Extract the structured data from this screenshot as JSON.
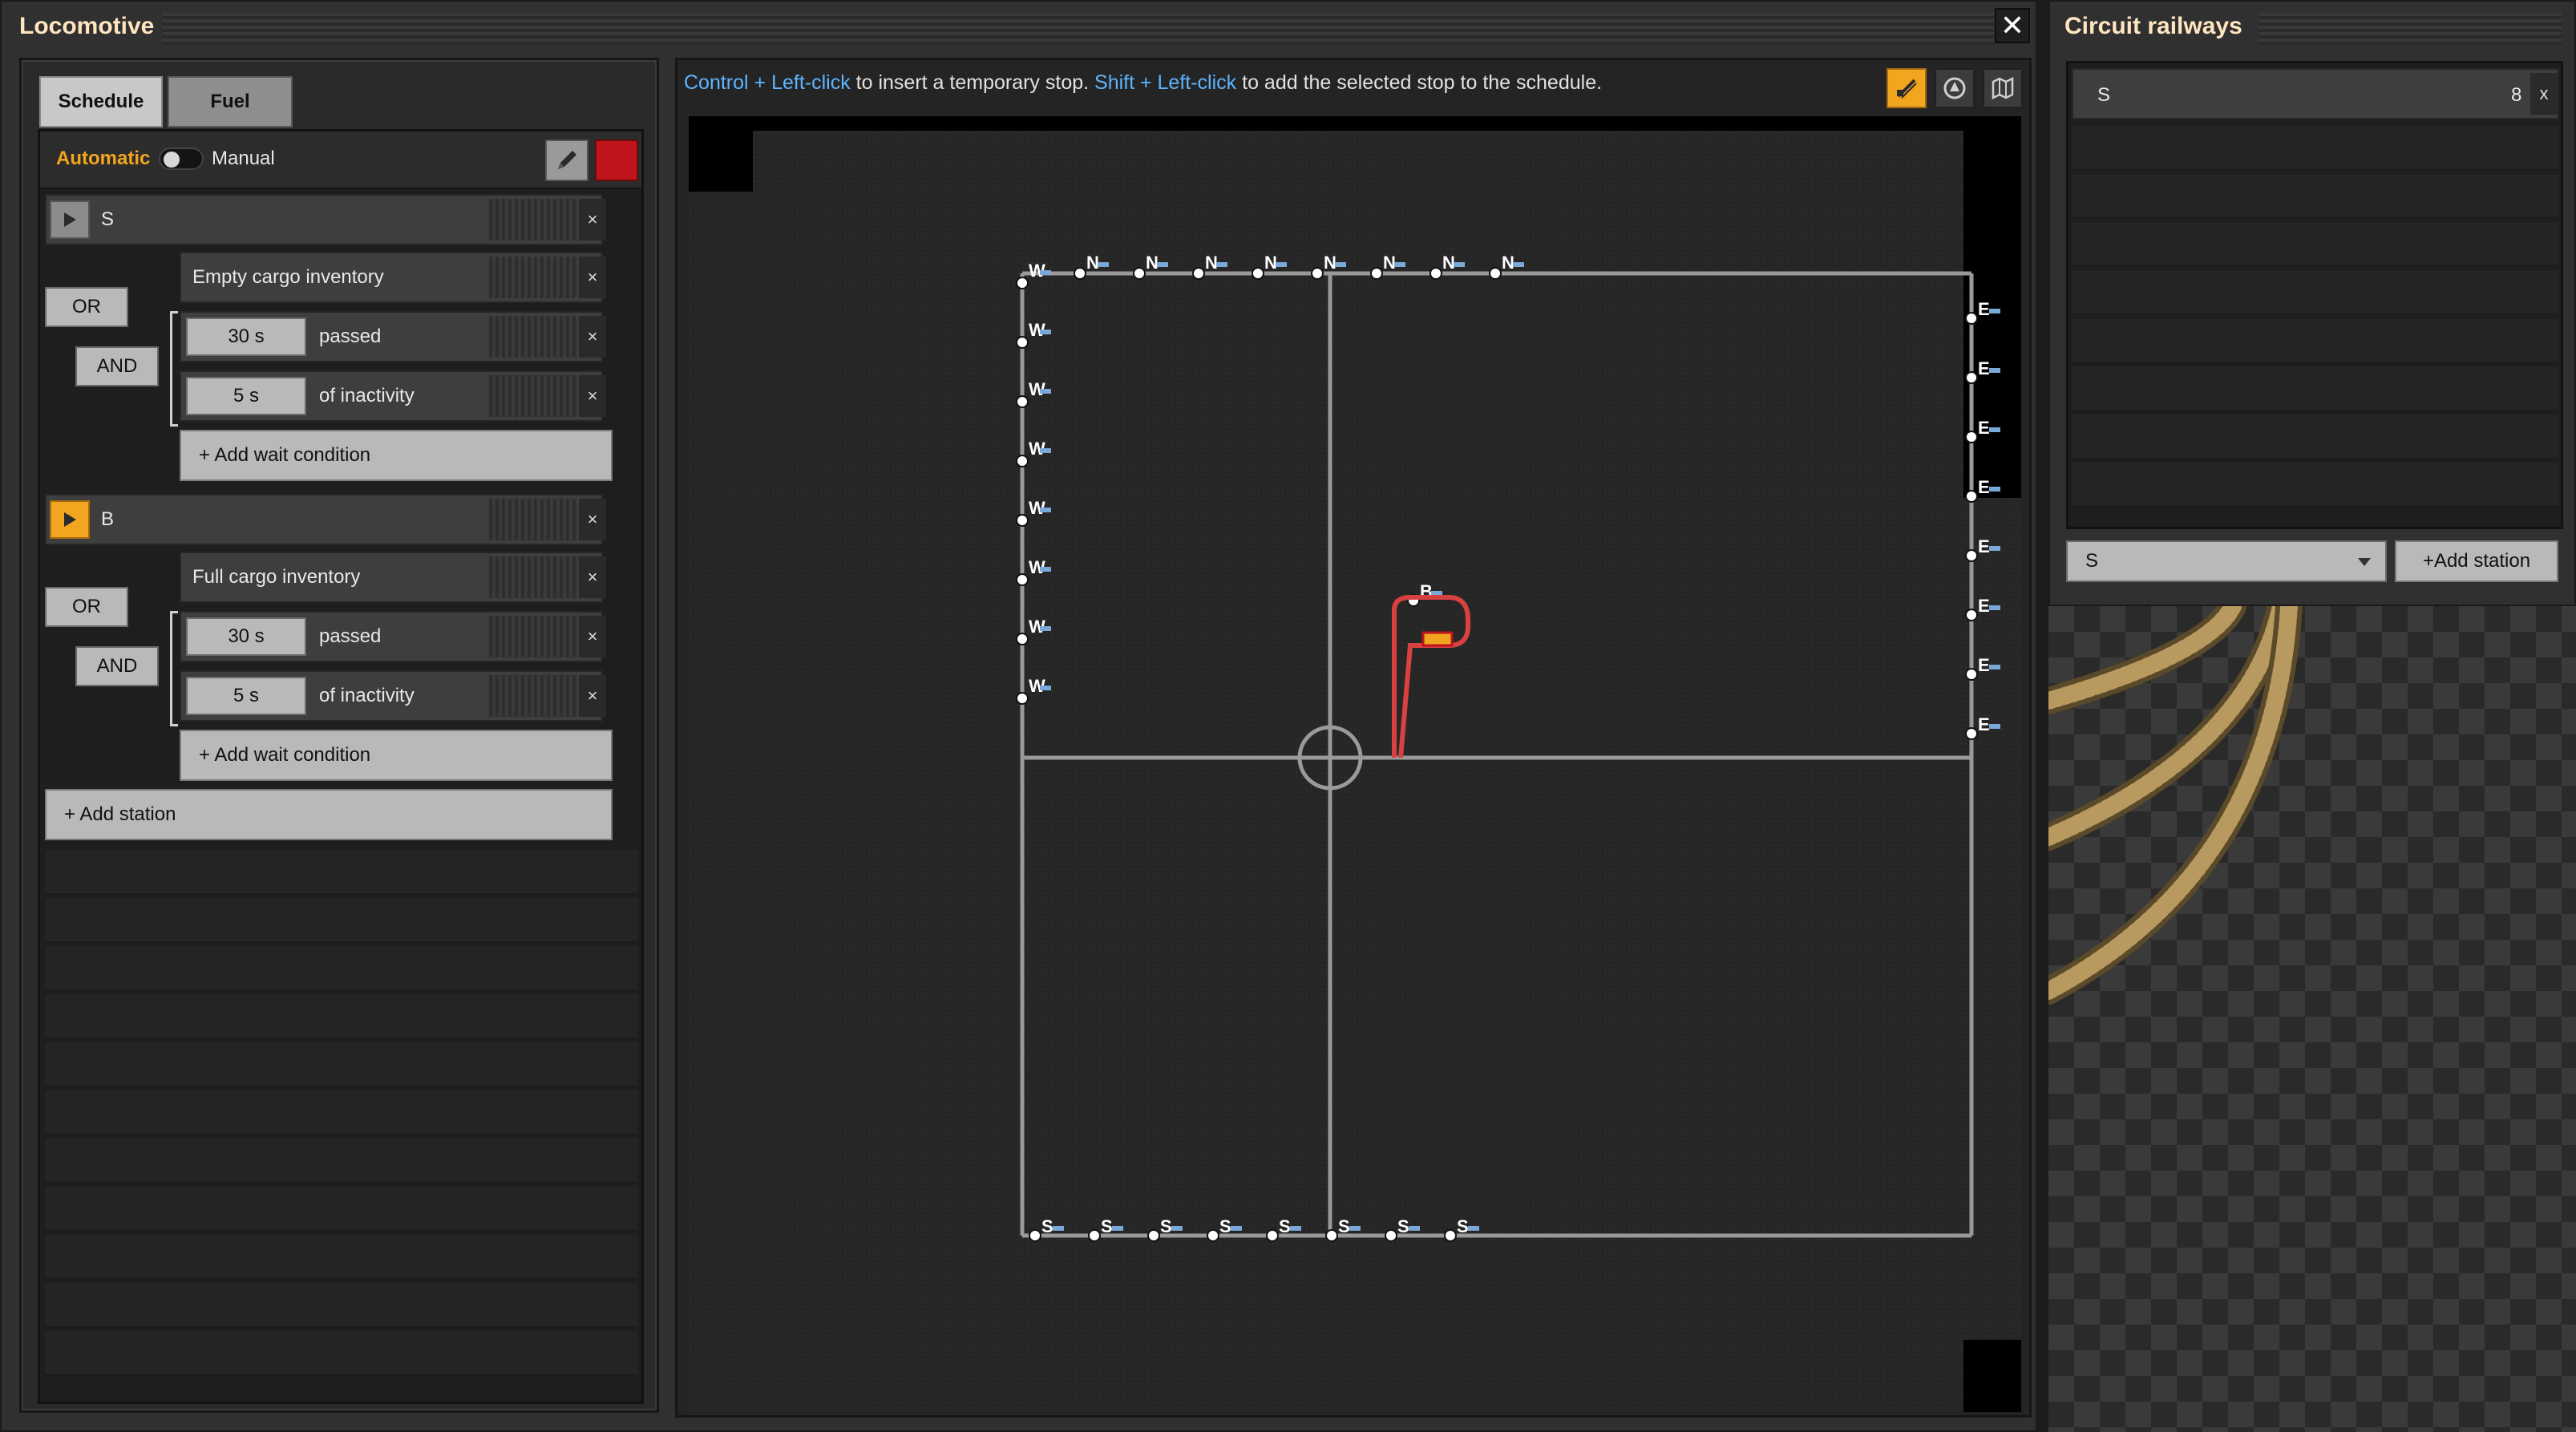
{
  "locomotive": {
    "title": "Locomotive",
    "close_glyph": "✕",
    "tabs": [
      {
        "label": "Schedule",
        "active": true
      },
      {
        "label": "Fuel",
        "active": false
      }
    ],
    "mode": {
      "automatic": "Automatic",
      "manual": "Manual"
    },
    "stations": [
      {
        "name": "S",
        "active": false,
        "conditions": [
          {
            "value": "",
            "text": "Empty cargo inventory"
          },
          {
            "value": "30 s",
            "text": "passed"
          },
          {
            "value": "5 s",
            "text": "of inactivity"
          }
        ],
        "or_label": "OR",
        "and_label": "AND",
        "add_condition": "+ Add wait condition"
      },
      {
        "name": "B",
        "active": true,
        "conditions": [
          {
            "value": "",
            "text": "Full cargo inventory"
          },
          {
            "value": "30 s",
            "text": "passed"
          },
          {
            "value": "5 s",
            "text": "of inactivity"
          }
        ],
        "or_label": "OR",
        "and_label": "AND",
        "add_condition": "+ Add wait condition"
      }
    ],
    "add_station": "+ Add station",
    "remove_glyph": "×"
  },
  "map": {
    "hint_part1": "Control + Left-click",
    "hint_part2": " to insert a temporary stop. ",
    "hint_part3": "Shift + Left-click",
    "hint_part4": " to add the selected stop to the schedule.",
    "icons": [
      "rail-tool-icon",
      "locomotive-icon",
      "map-icon"
    ],
    "station_labels": {
      "north": "N",
      "south": "S",
      "east": "E",
      "west": "W",
      "center": "B"
    }
  },
  "circuit": {
    "title": "Circuit railways",
    "list": [
      {
        "name": "S",
        "count": "8",
        "remove": "x"
      }
    ],
    "dropdown_value": "S",
    "add_station": "+Add station"
  },
  "colors": {
    "accent_orange": "#f2a51e",
    "hint_blue": "#5fb4ff",
    "stop_red": "#c0141c",
    "rail": "#9a9a9a"
  }
}
